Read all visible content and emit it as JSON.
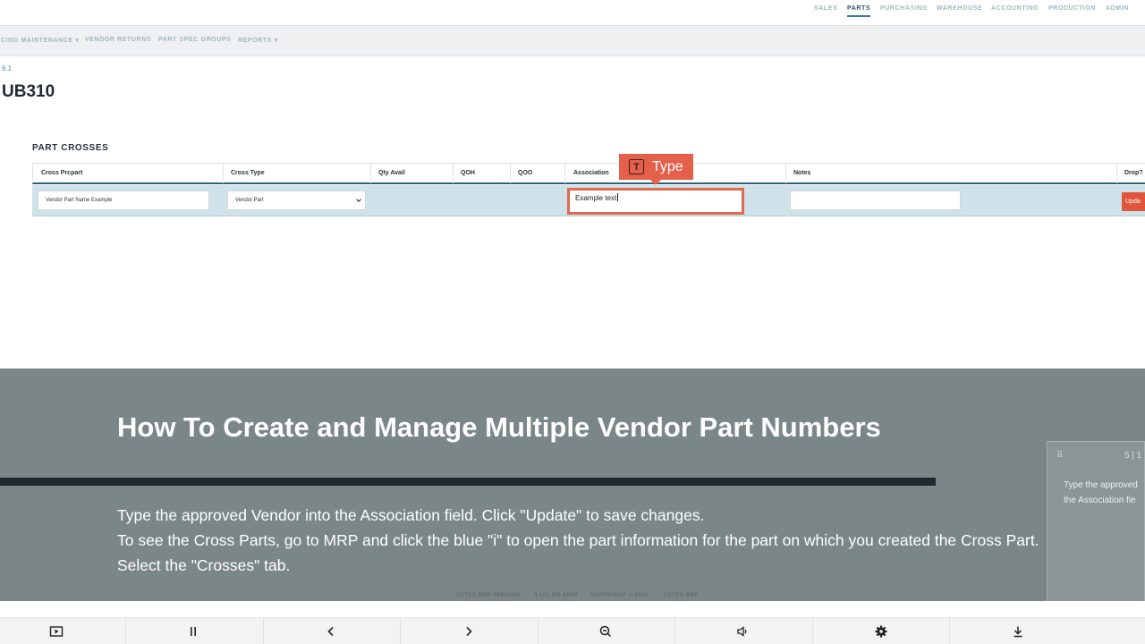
{
  "top_nav": {
    "items": [
      "SALES",
      "PARTS",
      "PURCHASING",
      "WAREHOUSE",
      "ACCOUNTING",
      "PRODUCTION",
      "ADMIN"
    ],
    "active": "PARTS"
  },
  "sub_nav": {
    "items": [
      "CING MAINTENANCE ▾",
      "VENDOR RETURNS",
      "PART SPEC GROUPS",
      "REPORTS ▾"
    ]
  },
  "version_link": "6.1",
  "part_title": "UB310",
  "section_title": "PART CROSSES",
  "table": {
    "headers": [
      "Cross Prcpart",
      "Cross Type",
      "Qty Avail",
      "QOH",
      "QOO",
      "Association",
      "Notes",
      "Drop?"
    ],
    "row": {
      "cross_prcpart": "Vendor Part Name Example",
      "cross_type": "Vendor Part",
      "association": "Example text",
      "notes": "",
      "update_label": "Upda"
    }
  },
  "type_badge": {
    "icon_letter": "T",
    "label": "Type"
  },
  "overlay": {
    "title": "How To Create and Manage Multiple Vendor Part Numbers",
    "lines": [
      "Type the approved Vendor into the Association field. Click \"Update\" to save changes.",
      "To see the Cross Parts, go to MRP and click the blue \"i\" to open the part information for the part on which you created the Cross Part.",
      "Select the \"Crosses\" tab."
    ]
  },
  "footer": {
    "version_label": "CETEC ERP VERSION",
    "version_value": "4.101 ON APP2",
    "copyright": "COPYRIGHT © 2022",
    "brand": "CETEC ERP"
  },
  "side_panel": {
    "grip": "⠿",
    "page": "5 | 1",
    "text_lines": [
      "Type the approved",
      "the  Association fie"
    ]
  },
  "player": {
    "icons": [
      "slideshow-icon",
      "pause-icon",
      "previous-icon",
      "next-icon",
      "zoom-out-icon",
      "volume-icon",
      "settings-icon",
      "download-icon"
    ]
  },
  "colors": {
    "accent": "#e5604a",
    "row_bg": "#cfe2ea",
    "overlay_bg": "#7b8689",
    "header_rule": "#2a6278"
  }
}
